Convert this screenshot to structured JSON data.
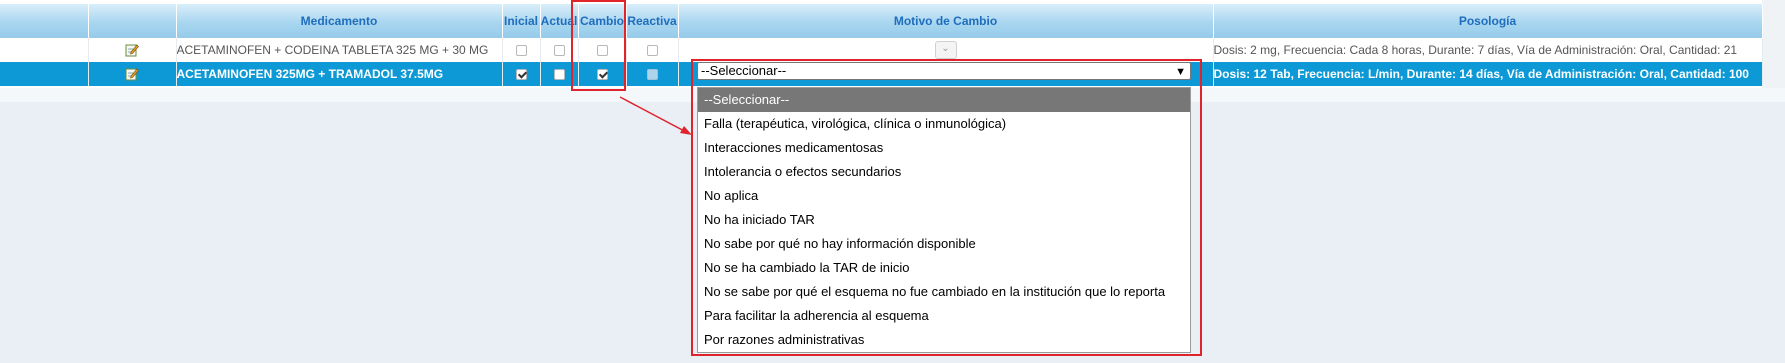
{
  "table": {
    "headers": {
      "medicamento": "Medicamento",
      "inicial": "Inicial",
      "actual": "Actual",
      "cambio": "Cambio",
      "reactiva": "Reactiva",
      "motivo": "Motivo de Cambio",
      "posologia": "Posología"
    },
    "rows": [
      {
        "medicamento": "ACETAMINOFEN + CODEINA TABLETA 325 MG + 30 MG",
        "inicial": false,
        "actual": false,
        "cambio": false,
        "reactiva": false,
        "posologia": "Dosis: 2 mg, Frecuencia: Cada 8 horas, Durante: 7 días, Vía de Administración: Oral, Cantidad: 21"
      },
      {
        "medicamento": "ACETAMINOFEN 325MG + TRAMADOL 37.5MG",
        "inicial": true,
        "actual": false,
        "cambio": true,
        "reactiva": false,
        "posologia": "Dosis: 12 Tab, Frecuencia: L/min, Durante: 14 días, Vía de Administración: Oral, Cantidad: 100"
      }
    ]
  },
  "motivo_select": {
    "value": "--Seleccionar--",
    "options": [
      "--Seleccionar--",
      "Falla (terapéutica, virológica, clínica o inmunológica)",
      "Interacciones medicamentosas",
      "Intolerancia o efectos secundarios",
      "No aplica",
      "No ha iniciado TAR",
      "No sabe por qué no hay información disponible",
      "No se ha cambiado la TAR de inicio",
      "No se sabe por qué el esquema no fue cambiado en la institución que lo reporta",
      "Para facilitar la adherencia al esquema",
      "Por razones administrativas"
    ]
  },
  "colors": {
    "header_text": "#1f6dbd",
    "selected_row": "#0c99d6",
    "highlight": "#e0242c"
  }
}
